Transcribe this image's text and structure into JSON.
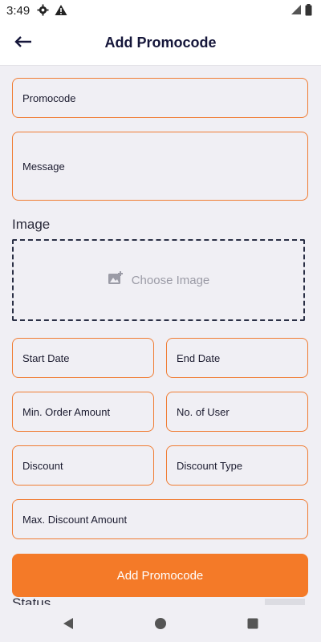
{
  "status_bar": {
    "time": "3:49"
  },
  "header": {
    "title": "Add Promocode"
  },
  "fields": {
    "promocode": "Promocode",
    "message": "Message",
    "start_date": "Start Date",
    "end_date": "End Date",
    "min_order_amount": "Min. Order Amount",
    "no_of_user": "No. of User",
    "discount": "Discount",
    "discount_type": "Discount Type",
    "max_discount_amount": "Max. Discount Amount"
  },
  "image_section": {
    "label": "Image",
    "choose_label": "Choose Image"
  },
  "actions": {
    "submit_label": "Add Promocode"
  },
  "status_section": {
    "label": "Status"
  },
  "colors": {
    "accent": "#f47a28",
    "border": "#f07c33",
    "title": "#15163a",
    "background": "#f0eff4"
  },
  "icons": [
    "settings-icon",
    "warning-icon",
    "signal-icon",
    "battery-icon",
    "back-arrow-icon",
    "image-icon",
    "nav-back-icon",
    "nav-home-icon",
    "nav-recents-icon"
  ]
}
